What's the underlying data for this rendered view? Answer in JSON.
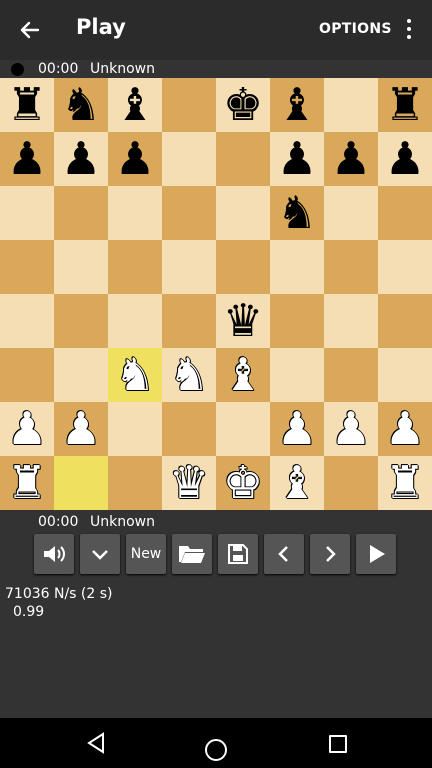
{
  "appbar": {
    "title": "Play",
    "options_label": "OPTIONS",
    "back_icon": "arrow-back-icon",
    "more_icon": "more-vert-icon"
  },
  "top_player": {
    "time": "00:00",
    "name": "Unknown",
    "turn_indicator": "black-dot"
  },
  "bottom_player": {
    "time": "00:00",
    "name": "Unknown"
  },
  "board": {
    "light_color": "#f5deb3",
    "dark_color": "#d9a85a",
    "highlight_color": "#f0e060",
    "ranks": [
      [
        "bR",
        "bN",
        "bB",
        "",
        "bK",
        "bB",
        "",
        "bR"
      ],
      [
        "bP",
        "bP",
        "bP",
        "",
        "",
        "bP",
        "bP",
        "bP"
      ],
      [
        "",
        "",
        "",
        "",
        "",
        "bN",
        "",
        ""
      ],
      [
        "",
        "",
        "",
        "",
        "",
        "",
        "",
        ""
      ],
      [
        "",
        "",
        "",
        "",
        "bQ",
        "",
        "",
        ""
      ],
      [
        "",
        "",
        "wN",
        "wN",
        "wB",
        "",
        "",
        ""
      ],
      [
        "wP",
        "wP",
        "",
        "",
        "",
        "wP",
        "wP",
        "wP"
      ],
      [
        "wR",
        "",
        "",
        "wQ",
        "wK",
        "wB",
        "",
        "wR"
      ]
    ],
    "highlighted": [
      "c3",
      "b1"
    ]
  },
  "toolbar": {
    "sound_icon": "volume-icon",
    "expand_icon": "chevron-down-icon",
    "new_label": "New",
    "open_icon": "folder-open-icon",
    "save_icon": "save-icon",
    "prev_icon": "chevron-left-icon",
    "next_icon": "chevron-right-icon",
    "play_icon": "play-icon"
  },
  "engine": {
    "speed": "71036 N/s (2 s)",
    "eval": "0.99"
  },
  "navbar": {
    "back_icon": "nav-back-icon",
    "home_icon": "nav-home-icon",
    "recent_icon": "nav-recent-icon"
  }
}
